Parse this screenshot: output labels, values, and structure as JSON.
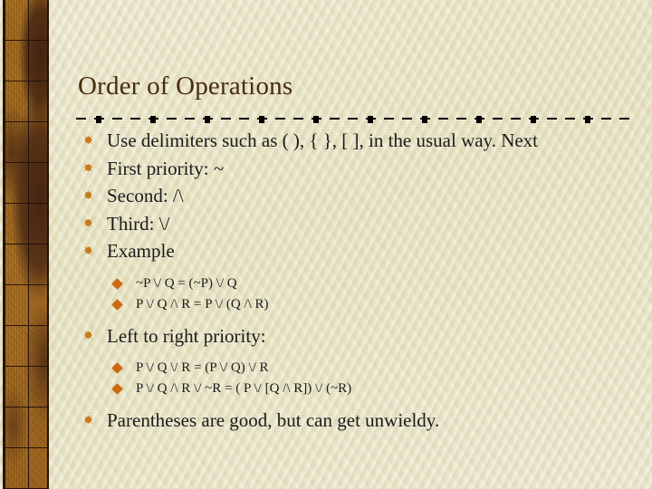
{
  "slide": {
    "title": "Order of Operations",
    "background_color": "#ece8c8",
    "title_color": "#4a2c10",
    "accent_color": "#c87d18",
    "sub_bullet_color": "#cc6a11",
    "border_color": "#b4761f"
  },
  "body": {
    "bullets": [
      {
        "level": 1,
        "text": "Use delimiters such as ( ), {  },  [  ], in the usual way.  Next"
      },
      {
        "level": 1,
        "text": "First priority:  ~"
      },
      {
        "level": 1,
        "text": "Second:  /\\"
      },
      {
        "level": 1,
        "text": "Third:  \\/"
      },
      {
        "level": 1,
        "text": "Example"
      },
      {
        "level": 2,
        "text": "~P \\/ Q = (~P) \\/ Q"
      },
      {
        "level": 2,
        "text": "P \\/ Q /\\ R = P \\/ (Q /\\ R)"
      },
      {
        "level": 1,
        "text": "Left to right priority:"
      },
      {
        "level": 2,
        "text": "P \\/ Q \\/ R = (P \\/ Q) \\/ R"
      },
      {
        "level": 2,
        "text": "P \\/ Q /\\ R \\/ ~R = ( P \\/ [Q /\\ R]) \\/ (~R)"
      },
      {
        "level": 1,
        "text": "Parentheses are good, but can get unwieldy."
      }
    ]
  },
  "icons": {
    "l1_bullet": "maltese-cross-bullet-icon",
    "l2_bullet": "diamond-bullet-icon"
  }
}
